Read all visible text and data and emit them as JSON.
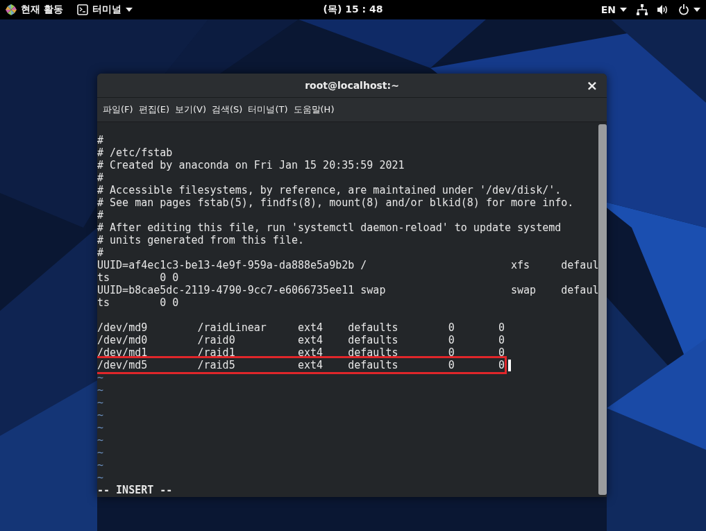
{
  "top_bar": {
    "activities": "현재 활동",
    "app_menu": "터미널",
    "clock": "(목) 15 : 48",
    "language": "EN"
  },
  "window": {
    "title": "root@localhost:~",
    "close": "×"
  },
  "menu": [
    {
      "label": "파일(F)"
    },
    {
      "label": "편집(E)"
    },
    {
      "label": "보기(V)"
    },
    {
      "label": "검색(S)"
    },
    {
      "label": "터미널(T)"
    },
    {
      "label": "도움말(H)"
    }
  ],
  "lines": [
    {
      "kind": "text",
      "text": "#",
      "highlighted": false,
      "cursor": false
    },
    {
      "kind": "text",
      "text": "# /etc/fstab",
      "highlighted": false,
      "cursor": false
    },
    {
      "kind": "text",
      "text": "# Created by anaconda on Fri Jan 15 20:35:59 2021",
      "highlighted": false,
      "cursor": false
    },
    {
      "kind": "text",
      "text": "#",
      "highlighted": false,
      "cursor": false
    },
    {
      "kind": "text",
      "text": "# Accessible filesystems, by reference, are maintained under '/dev/disk/'.",
      "highlighted": false,
      "cursor": false
    },
    {
      "kind": "text",
      "text": "# See man pages fstab(5), findfs(8), mount(8) and/or blkid(8) for more info.",
      "highlighted": false,
      "cursor": false
    },
    {
      "kind": "text",
      "text": "#",
      "highlighted": false,
      "cursor": false
    },
    {
      "kind": "text",
      "text": "# After editing this file, run 'systemctl daemon-reload' to update systemd",
      "highlighted": false,
      "cursor": false
    },
    {
      "kind": "text",
      "text": "# units generated from this file.",
      "highlighted": false,
      "cursor": false
    },
    {
      "kind": "text",
      "text": "#",
      "highlighted": false,
      "cursor": false
    },
    {
      "kind": "text",
      "text": "UUID=af4ec1c3-be13-4e9f-959a-da888e5a9b2b /                       xfs     defaul",
      "highlighted": false,
      "cursor": false
    },
    {
      "kind": "text",
      "text": "ts        0 0",
      "highlighted": false,
      "cursor": false
    },
    {
      "kind": "text",
      "text": "UUID=b8cae5dc-2119-4790-9cc7-e6066735ee11 swap                    swap    defaul",
      "highlighted": false,
      "cursor": false
    },
    {
      "kind": "text",
      "text": "ts        0 0",
      "highlighted": false,
      "cursor": false
    },
    {
      "kind": "blank"
    },
    {
      "kind": "text",
      "text": "/dev/md9        /raidLinear     ext4    defaults        0       0",
      "highlighted": false,
      "cursor": false
    },
    {
      "kind": "text",
      "text": "/dev/md0        /raid0          ext4    defaults        0       0",
      "highlighted": false,
      "cursor": false
    },
    {
      "kind": "text",
      "text": "/dev/md1        /raid1          ext4    defaults        0       0",
      "highlighted": false,
      "cursor": false
    },
    {
      "kind": "text",
      "text": "/dev/md5        /raid5          ext4    defaults        0       0",
      "highlighted": true,
      "cursor": true
    },
    {
      "kind": "tilde",
      "text": "~"
    },
    {
      "kind": "tilde",
      "text": "~"
    },
    {
      "kind": "tilde",
      "text": "~"
    },
    {
      "kind": "tilde",
      "text": "~"
    },
    {
      "kind": "tilde",
      "text": "~"
    },
    {
      "kind": "tilde",
      "text": "~"
    },
    {
      "kind": "tilde",
      "text": "~"
    },
    {
      "kind": "tilde",
      "text": "~"
    },
    {
      "kind": "tilde",
      "text": "~"
    }
  ],
  "status": "-- INSERT --"
}
